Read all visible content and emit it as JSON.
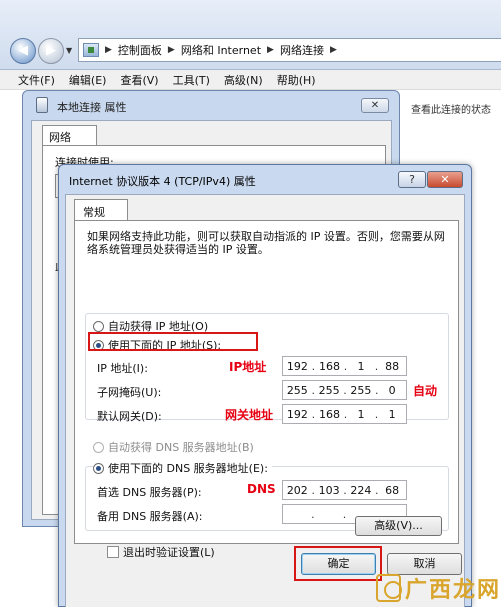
{
  "explorer": {
    "breadcrumb": [
      "控制面板",
      "网络和 Internet",
      "网络连接"
    ],
    "menu": [
      "文件(F)",
      "编辑(E)",
      "查看(V)",
      "工具(T)",
      "高级(N)",
      "帮助(H)"
    ],
    "side_text": "查看此连接的状态"
  },
  "props_window": {
    "title": "本地连接 属性",
    "tab": "网络",
    "connect_label": "连接时使用:",
    "fragment_label": "此"
  },
  "ipv4_dialog": {
    "title": "Internet 协议版本 4 (TCP/IPv4) 属性",
    "help_label": "?",
    "close_label": "✕",
    "tab_label": "常规",
    "intro": "如果网络支持此功能，则可以获取自动指派的 IP 设置。否则，您需要从网络系统管理员处获得适当的 IP 设置。",
    "auto_ip_label": "自动获得 IP 地址(O)",
    "manual_ip_label": "使用下面的 IP 地址(S):",
    "ip_label": "IP 地址(I):",
    "ip_value": [
      "192",
      "168",
      "1",
      "88"
    ],
    "mask_label": "子网掩码(U):",
    "mask_value": [
      "255",
      "255",
      "255",
      "0"
    ],
    "gateway_label": "默认网关(D):",
    "gateway_value": [
      "192",
      "168",
      "1",
      "1"
    ],
    "auto_dns_label": "自动获得 DNS 服务器地址(B)",
    "manual_dns_label": "使用下面的 DNS 服务器地址(E):",
    "pref_dns_label": "首选 DNS 服务器(P):",
    "pref_dns_value": [
      "202",
      "103",
      "224",
      "68"
    ],
    "alt_dns_label": "备用 DNS 服务器(A):",
    "alt_dns_value": [
      "",
      "",
      "",
      ""
    ],
    "validate_label": "退出时验证设置(L)",
    "advanced_label": "高级(V)...",
    "ok_label": "确定",
    "cancel_label": "取消"
  },
  "annotations": {
    "ip_note": "IP地址",
    "auto_note": "自动",
    "gateway_note": "网关地址",
    "dns_note": "DNS",
    "accent": "#e60012"
  },
  "watermark": "广西龙网"
}
